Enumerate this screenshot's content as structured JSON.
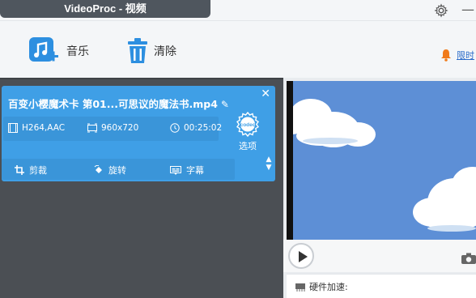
{
  "window": {
    "title": "VideoProc - 视频"
  },
  "toolbar": {
    "music_label": "音乐",
    "clear_label": "清除",
    "alert_text": "限时"
  },
  "video_card": {
    "filename": "百变小樱魔术卡 第01...可思议的魔法书.mp4",
    "codec": "H264,AAC",
    "resolution": "960x720",
    "duration": "00:25:02",
    "codec_icon_text": "codec",
    "codec_option_label": "选项",
    "actions": {
      "crop": "剪裁",
      "rotate": "旋转",
      "subtitle": "字幕"
    }
  },
  "preview": {
    "hw_accel_label": "硬件加速:"
  },
  "colors": {
    "accent_blue": "#3f9fe6",
    "dark_panel": "#4b4f54",
    "title_pill": "#4f565e",
    "sky": "#5d8fd6"
  }
}
